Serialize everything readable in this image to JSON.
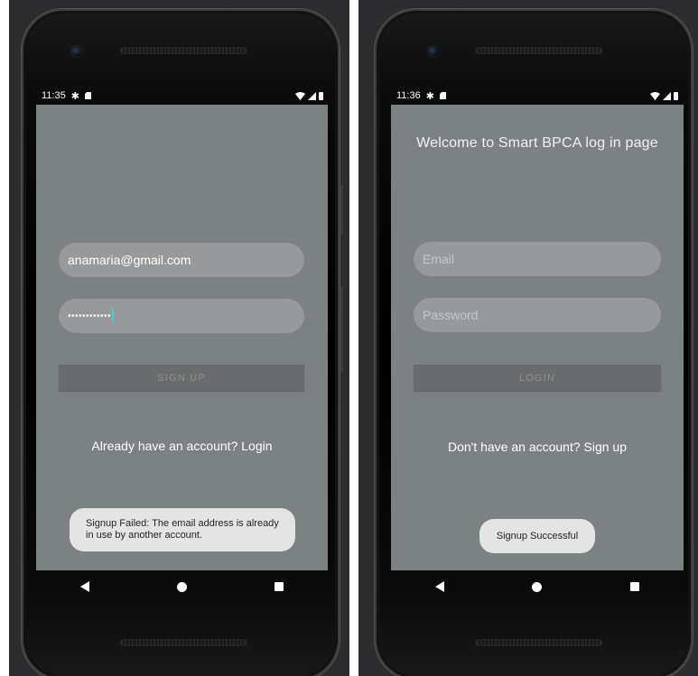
{
  "left_phone": {
    "time": "11:35",
    "email_value": "anamaria@gmail.com",
    "password_value": "••••••••••••",
    "button_label": "SIGN UP",
    "link_text": "Already have an account? Login",
    "toast_text": "Signup Failed: The email address is already in use by another account."
  },
  "right_phone": {
    "time": "11:36",
    "title": "Welcome to Smart BPCA log in page",
    "email_placeholder": "Email",
    "password_placeholder": "Password",
    "button_label": "LOGIN",
    "link_text": "Don't have an account? Sign up",
    "toast_text": "Signup Successful"
  },
  "status_icons": {
    "settings": "gear-icon",
    "sd_card": "sd-card-icon",
    "wifi": "wifi-icon",
    "signal": "signal-icon",
    "battery": "battery-icon"
  },
  "nav_icons": [
    "back-icon",
    "home-icon",
    "recents-icon"
  ],
  "colors": {
    "screen": "#7c8183",
    "field": "#97999b",
    "button": "#6a6b6c",
    "toast": "#e4e4e4",
    "cursor": "#3fd0c8"
  }
}
